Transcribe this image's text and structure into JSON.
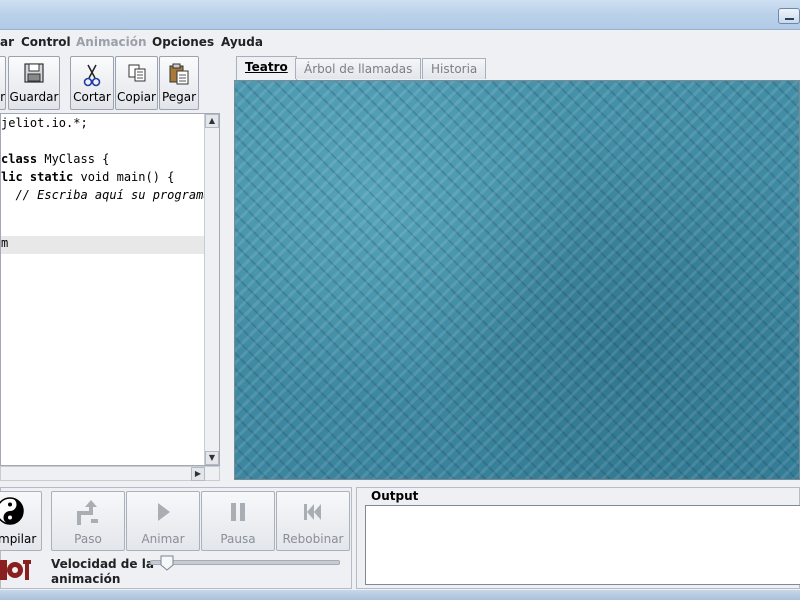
{
  "menu": {
    "items": [
      {
        "label": "ar",
        "enabled": true
      },
      {
        "label": "Control",
        "enabled": true
      },
      {
        "label": "Animación",
        "enabled": false
      },
      {
        "label": "Opciones",
        "enabled": true
      },
      {
        "label": "Ayuda",
        "enabled": true
      }
    ]
  },
  "toolbar": {
    "partial_label": "r",
    "save_label": "Guardar",
    "cut_label": "Cortar",
    "copy_label": "Copiar",
    "paste_label": "Pegar"
  },
  "editor": {
    "lines": [
      {
        "pre": "",
        "kw": "",
        "text": "jeliot.io.*;",
        "comment": ""
      },
      {
        "pre": "",
        "kw": "",
        "text": "",
        "comment": ""
      },
      {
        "pre": "",
        "kw": "",
        "text": "class MyClass {",
        "comment": ""
      },
      {
        "pre": "",
        "kw": "lic static ",
        "text": "void main() {",
        "comment": ""
      },
      {
        "pre": "  ",
        "kw": "",
        "text": "",
        "comment": "// Escriba aquí su programa."
      },
      {
        "pre": "",
        "kw": "",
        "text": "",
        "comment": ""
      },
      {
        "pre": "",
        "kw": "",
        "text": "m",
        "comment": ""
      }
    ]
  },
  "tabs": [
    {
      "label": "Teatro",
      "active": true
    },
    {
      "label": "Árbol de llamadas",
      "active": false
    },
    {
      "label": "Historia",
      "active": false
    }
  ],
  "controls": {
    "compile_label": "mpilar",
    "step_label": "Paso",
    "animate_label": "Animar",
    "pause_label": "Pausa",
    "rewind_label": "Rebobinar",
    "speed_label_1": "Velocidad de la",
    "speed_label_2": "animación",
    "speed_value": 0.1
  },
  "output": {
    "title": "Output",
    "text": ""
  },
  "colors": {
    "theatre_bg": "#3f8aa3",
    "titlebar": "#bcd2ea"
  }
}
